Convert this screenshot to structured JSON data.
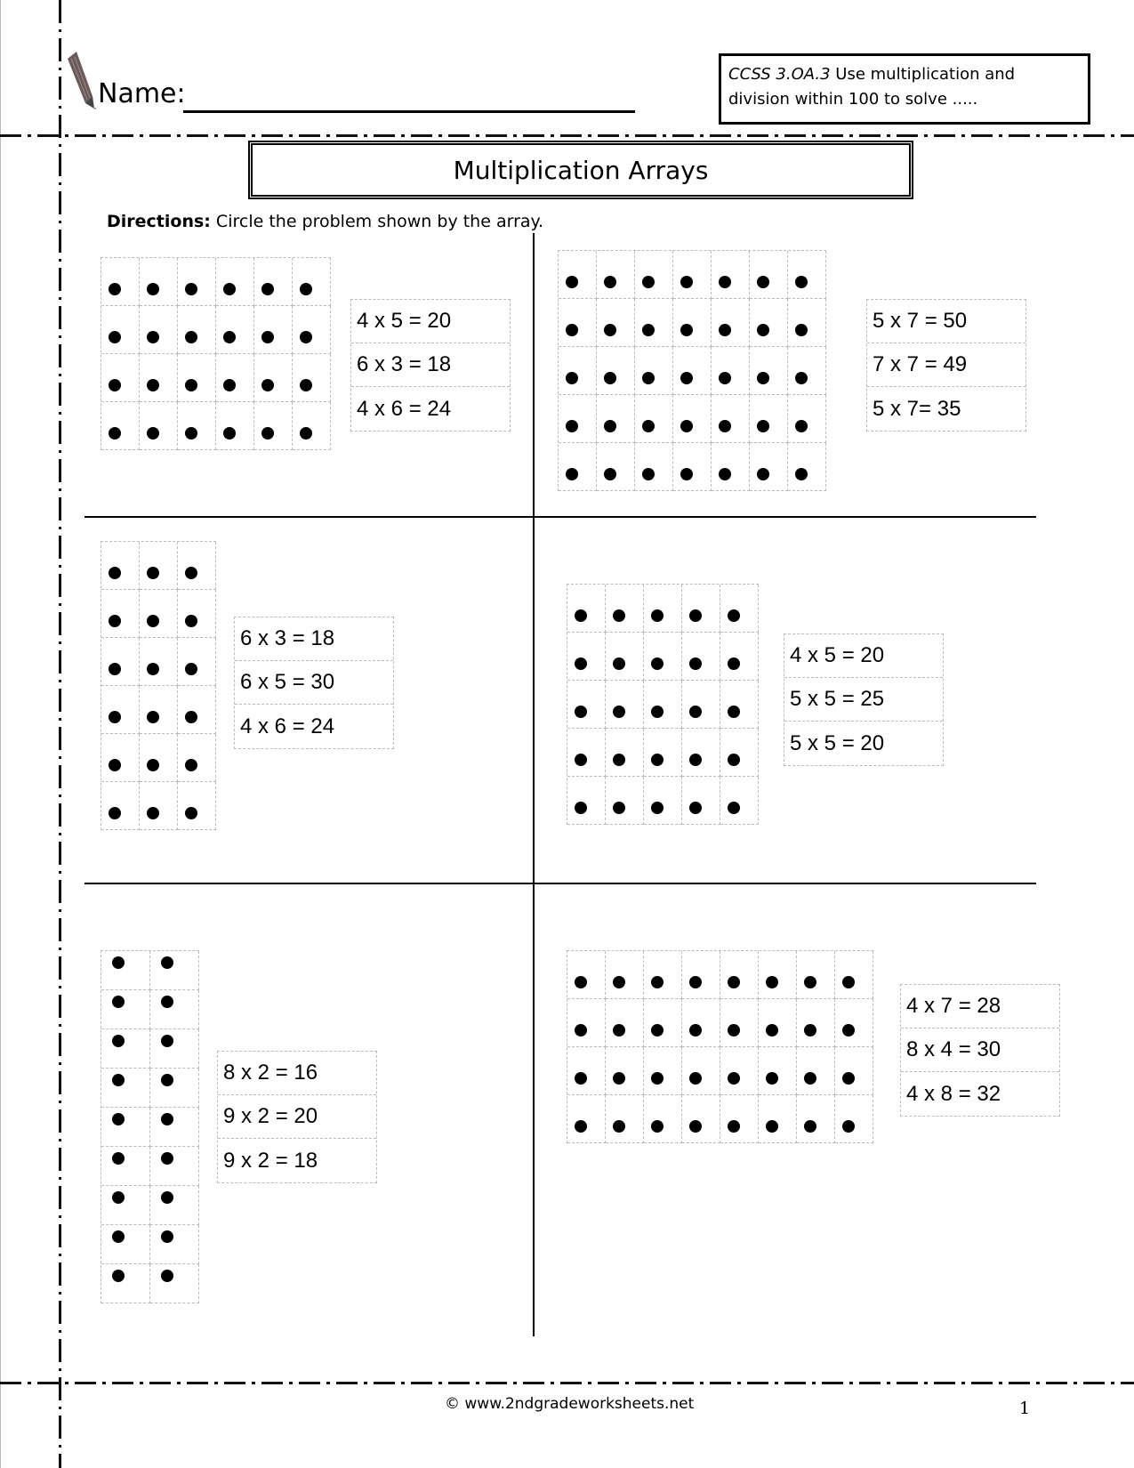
{
  "header": {
    "name_label": "Name:",
    "standard_code": "CCSS  3.OA.3",
    "standard_line1_rest": "  Use multiplication and",
    "standard_line2": "division within 100 to solve ....."
  },
  "title": "Multiplication Arrays",
  "directions": {
    "label": "Directions:",
    "text": " Circle the problem shown by the array."
  },
  "problems": [
    {
      "id": "p1",
      "rows": 4,
      "cols": 6,
      "choices": [
        "4 x 5 = 20",
        "6 x 3 = 18",
        "4 x 6 = 24"
      ]
    },
    {
      "id": "p2",
      "rows": 5,
      "cols": 7,
      "choices": [
        "5 x 7 = 50",
        "7 x 7 = 49",
        "5 x 7= 35"
      ]
    },
    {
      "id": "p3",
      "rows": 6,
      "cols": 3,
      "choices": [
        "6 x 3 = 18",
        "6 x 5 = 30",
        "4 x 6 = 24"
      ]
    },
    {
      "id": "p4",
      "rows": 5,
      "cols": 5,
      "choices": [
        "4 x 5 = 20",
        "5 x 5 = 25",
        "5 x 5 = 20"
      ]
    },
    {
      "id": "p5",
      "rows": 9,
      "cols": 2,
      "choices": [
        "8 x 2 = 16",
        "9 x 2 = 20",
        "9 x 2 = 18"
      ]
    },
    {
      "id": "p6",
      "rows": 4,
      "cols": 8,
      "choices": [
        "4 x 7 = 28",
        "8 x 4 = 30",
        "4 x 8 = 32"
      ]
    }
  ],
  "footer": {
    "copyright": "© www.2ndgradeworksheets.net",
    "page_number": "1"
  }
}
